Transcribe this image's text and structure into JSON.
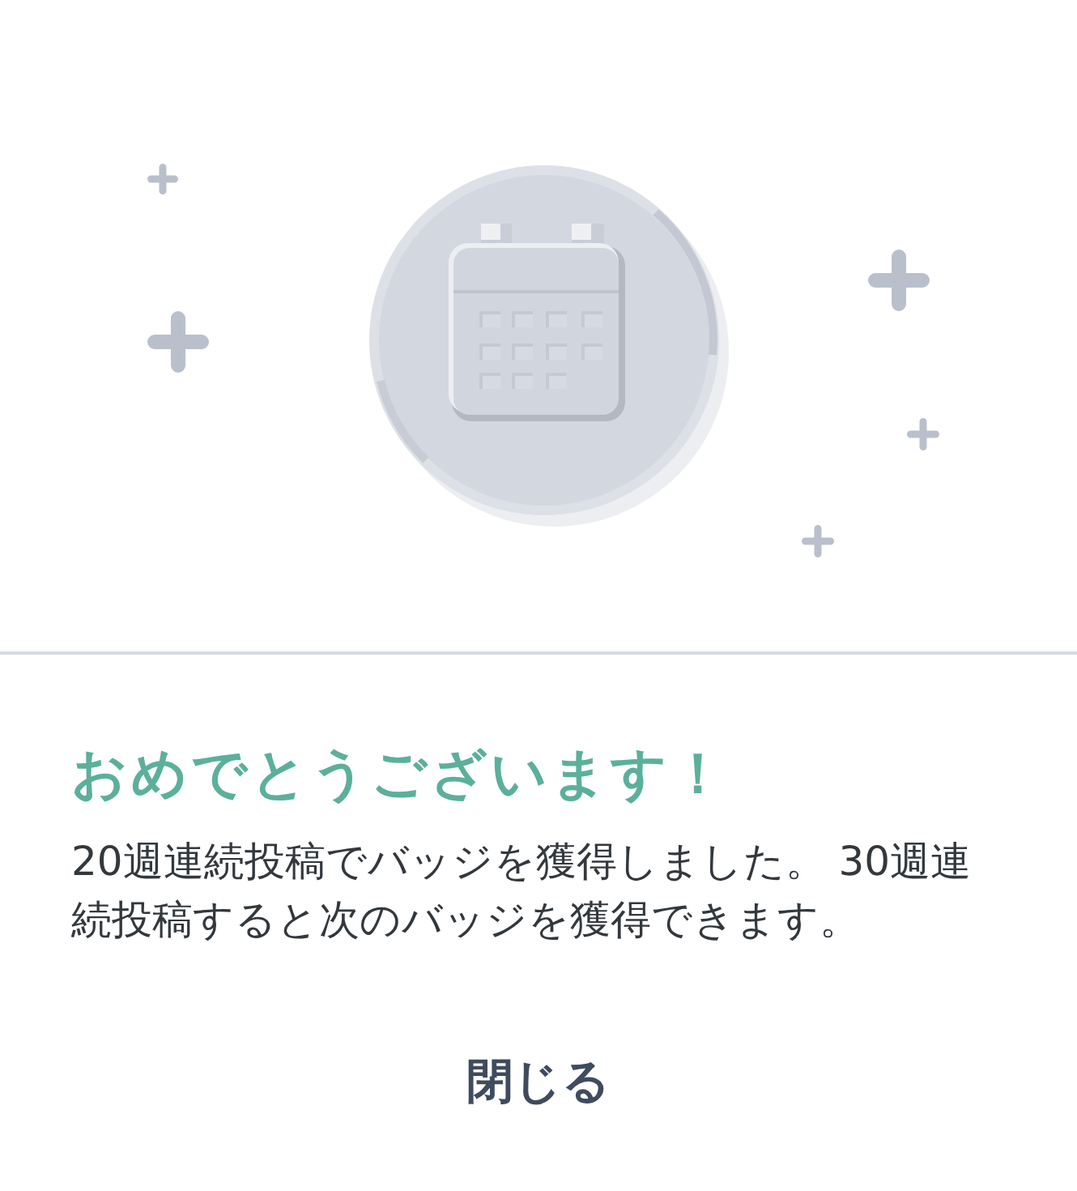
{
  "title": "おめでとうございます！",
  "message": "20週連続投稿でバッジを獲得しました。 30週連続投稿すると次のバッジを獲得できます。",
  "close_button": {
    "label": "閉じる"
  }
}
